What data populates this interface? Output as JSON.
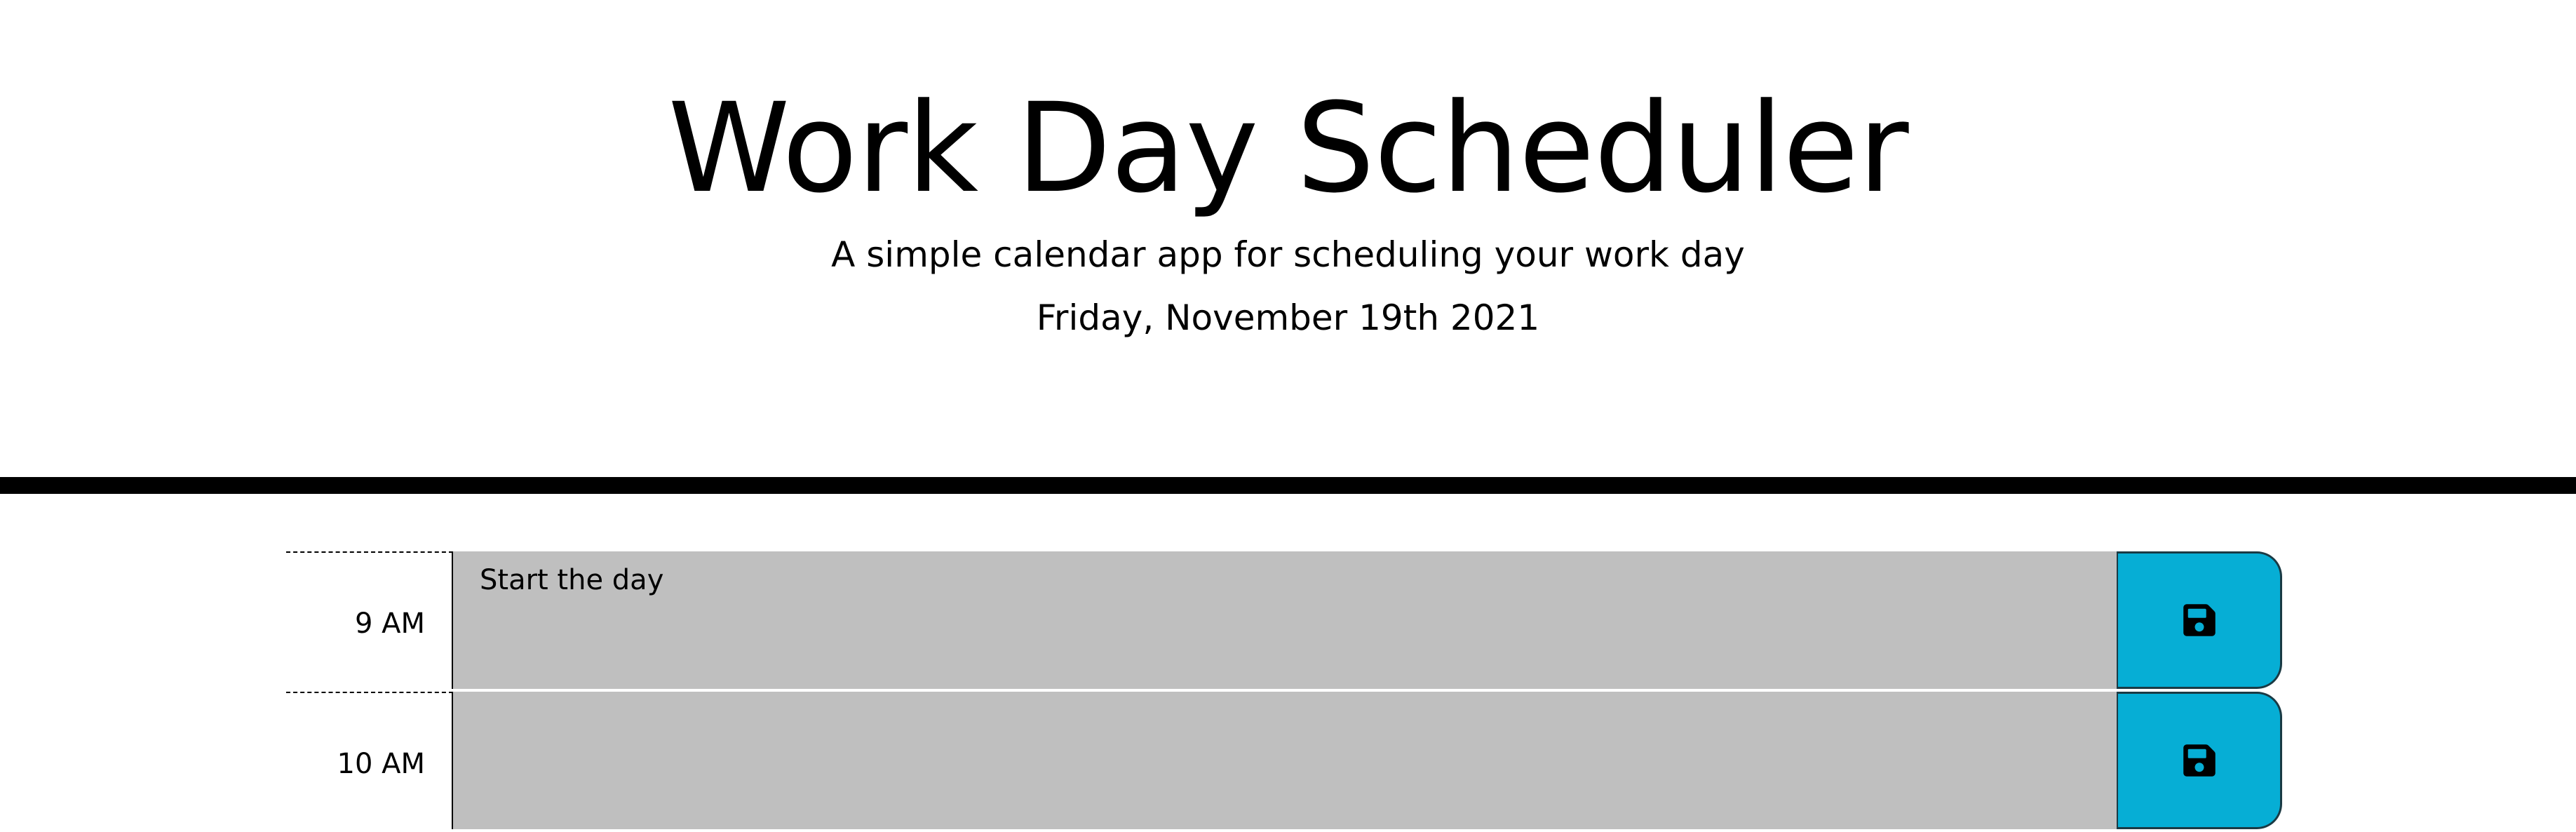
{
  "header": {
    "title": "Work Day Scheduler",
    "lead": "A simple calendar app for scheduling your work day",
    "date": "Friday, November 19th 2021"
  },
  "colors": {
    "row_gray": "#bfbfbf",
    "save_button": "#06aed5",
    "divider": "#000000"
  },
  "rows": [
    {
      "hour": "9 AM",
      "text": "Start the day",
      "save_icon": "floppy-disk-icon"
    },
    {
      "hour": "10 AM",
      "text": "",
      "save_icon": "floppy-disk-icon"
    }
  ]
}
